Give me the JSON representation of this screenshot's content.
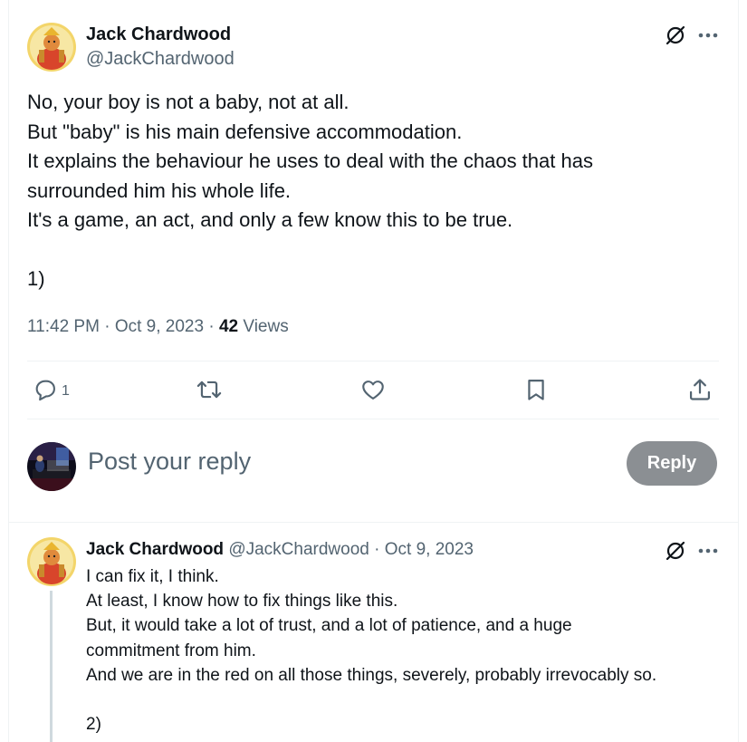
{
  "main_post": {
    "author_name": "Jack Chardwood",
    "author_handle": "@JackChardwood",
    "text_lines": [
      "No, your boy is not a baby, not at all.",
      "But \"baby\" is his main defensive accommodation.",
      "It explains the behaviour he uses to deal with the chaos that has",
      "surrounded him his whole life.",
      "It's a game, an act, and only a few know this to be true.",
      "",
      "1)"
    ],
    "time": "11:42 PM",
    "date": "Oct 9, 2023",
    "views_count": "42",
    "views_label": "Views",
    "separator": "·"
  },
  "actions": {
    "reply_count": "1",
    "icons": [
      "reply-icon",
      "repost-icon",
      "like-icon",
      "bookmark-icon",
      "share-icon"
    ]
  },
  "composer": {
    "placeholder": "Post your reply",
    "button_label": "Reply"
  },
  "reply_post": {
    "author_name": "Jack Chardwood",
    "author_handle": "@JackChardwood",
    "date": "Oct 9, 2023",
    "separator": "·",
    "text_lines": [
      "I can fix it, I think.",
      "At least, I know how to fix things like this.",
      "But, it would take a lot of trust, and a lot of patience, and a huge",
      "commitment from him.",
      "And we are in the red on all those things, severely, probably irrevocably so.",
      "",
      "2)"
    ]
  },
  "colors": {
    "text": "#0f1419",
    "secondary": "#536471",
    "divider": "#eff3f4",
    "reply_button": "#8b8f93",
    "thread_line": "#cfd9de"
  }
}
